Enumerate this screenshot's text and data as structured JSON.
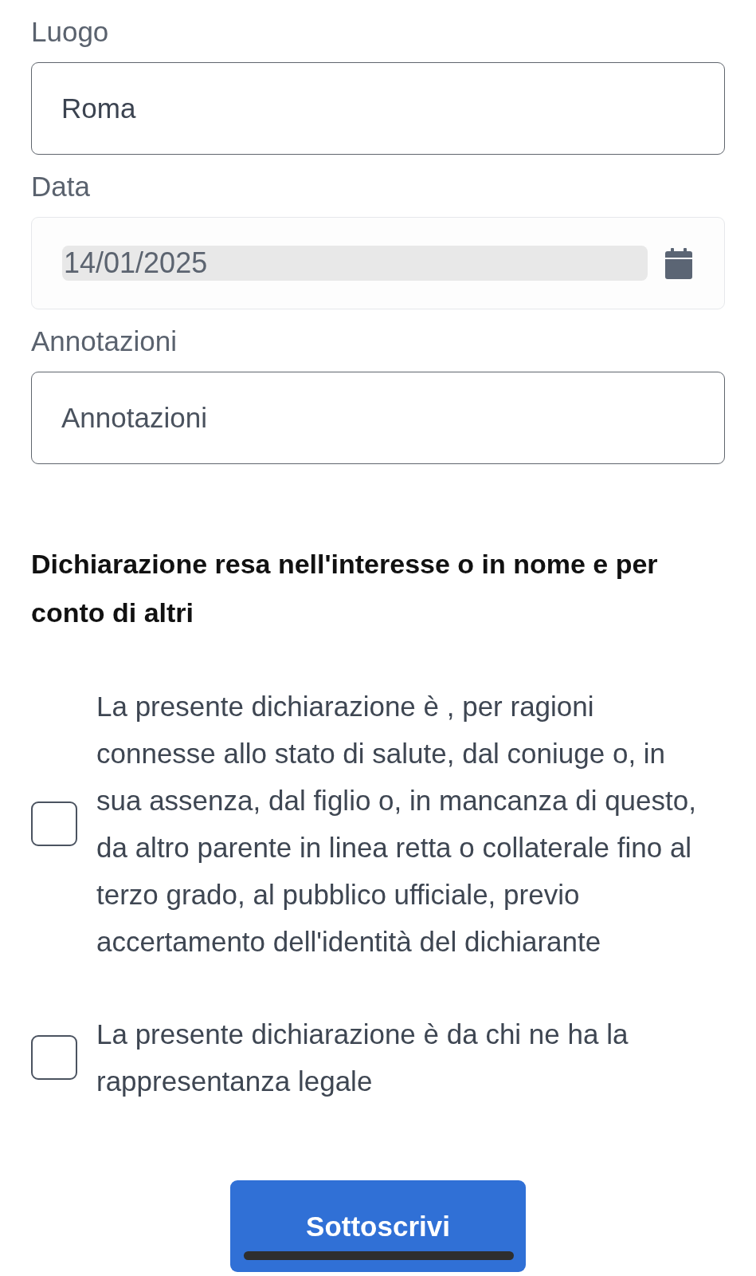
{
  "fields": [
    {
      "label": "Luogo",
      "kind": "text",
      "value": "Roma"
    },
    {
      "label": "Data",
      "kind": "date",
      "value": "14/01/2025"
    },
    {
      "label": "Annotazioni",
      "kind": "text",
      "placeholder": "Annotazioni"
    }
  ],
  "section": {
    "title": "Dichiarazione resa nell'interesse o in nome e per conto di altri",
    "options": [
      {
        "label": "La presente dichiarazione è , per ragioni connesse allo stato di salute, dal coniuge o, in sua assenza, dal figlio o, in mancanza di questo, da altro parente in linea retta o collaterale fino al terzo grado, al pubblico ufficiale, previo accertamento dell'identità del dichiarante",
        "checked": false
      },
      {
        "label": "La presente dichiarazione è da chi ne ha la rappresentanza legale",
        "checked": false
      }
    ]
  },
  "submit_button": {
    "label": "Sottoscrivi"
  }
}
